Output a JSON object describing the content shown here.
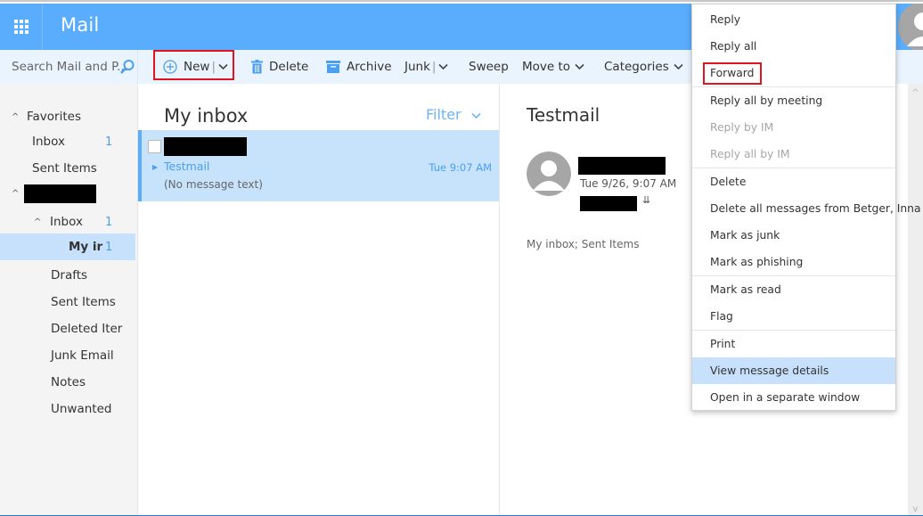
{
  "app": {
    "title": "Mail",
    "accent_color": "#5aadfc",
    "highlight_color": "#e0141e"
  },
  "header": {
    "app_launcher_icon": "waffle-grid-icon",
    "title": "Mail",
    "user_avatar_icon": "person-icon"
  },
  "search": {
    "placeholder": "Search Mail and P...",
    "icon": "search-icon"
  },
  "toolbar": {
    "new_label": "New",
    "delete_label": "Delete",
    "archive_label": "Archive",
    "junk_label": "Junk",
    "sweep_label": "Sweep",
    "move_to_label": "Move to",
    "categories_label": "Categories"
  },
  "nav": {
    "favorites_label": "Favorites",
    "fav_inbox_label": "Inbox",
    "fav_inbox_count": "1",
    "fav_sent_label": "Sent Items",
    "account_label": "",
    "inbox_label": "Inbox",
    "inbox_count": "1",
    "my_inbox_label": "My ir",
    "my_inbox_count": "1",
    "drafts_label": "Drafts",
    "sent_label": "Sent Items",
    "deleted_label": "Deleted Iter",
    "junk_label": "Junk Email",
    "notes_label": "Notes",
    "unwanted_label": "Unwanted"
  },
  "message_list": {
    "title": "My inbox",
    "filter_label": "Filter",
    "messages": [
      {
        "sender": "",
        "subject": "Testmail",
        "time": "Tue 9:07 AM",
        "preview": "(No message text)",
        "selected": true
      }
    ]
  },
  "reading_pane": {
    "subject": "Testmail",
    "date": "Tue 9/26, 9:07 AM",
    "folders": "My inbox; Sent Items",
    "expand_icon": "double-chevron-down-icon"
  },
  "context_menu": {
    "items": [
      {
        "label": "Reply",
        "disabled": false
      },
      {
        "label": "Reply all",
        "disabled": false
      },
      {
        "label": "Forward",
        "disabled": false,
        "highlighted_box": true
      },
      {
        "label": "Reply all by meeting",
        "disabled": false
      },
      {
        "label": "Reply by IM",
        "disabled": true
      },
      {
        "label": "Reply all by IM",
        "disabled": true
      },
      {
        "label": "Delete",
        "disabled": false
      },
      {
        "label": "Delete all messages from Betger, Inna",
        "disabled": false
      },
      {
        "label": "Mark as junk",
        "disabled": false
      },
      {
        "label": "Mark as phishing",
        "disabled": false
      },
      {
        "label": "Mark as read",
        "disabled": false
      },
      {
        "label": "Flag",
        "disabled": false
      },
      {
        "label": "Print",
        "disabled": false
      },
      {
        "label": "View message details",
        "disabled": false,
        "hovered": true
      },
      {
        "label": "Open in a separate window",
        "disabled": false
      }
    ]
  }
}
